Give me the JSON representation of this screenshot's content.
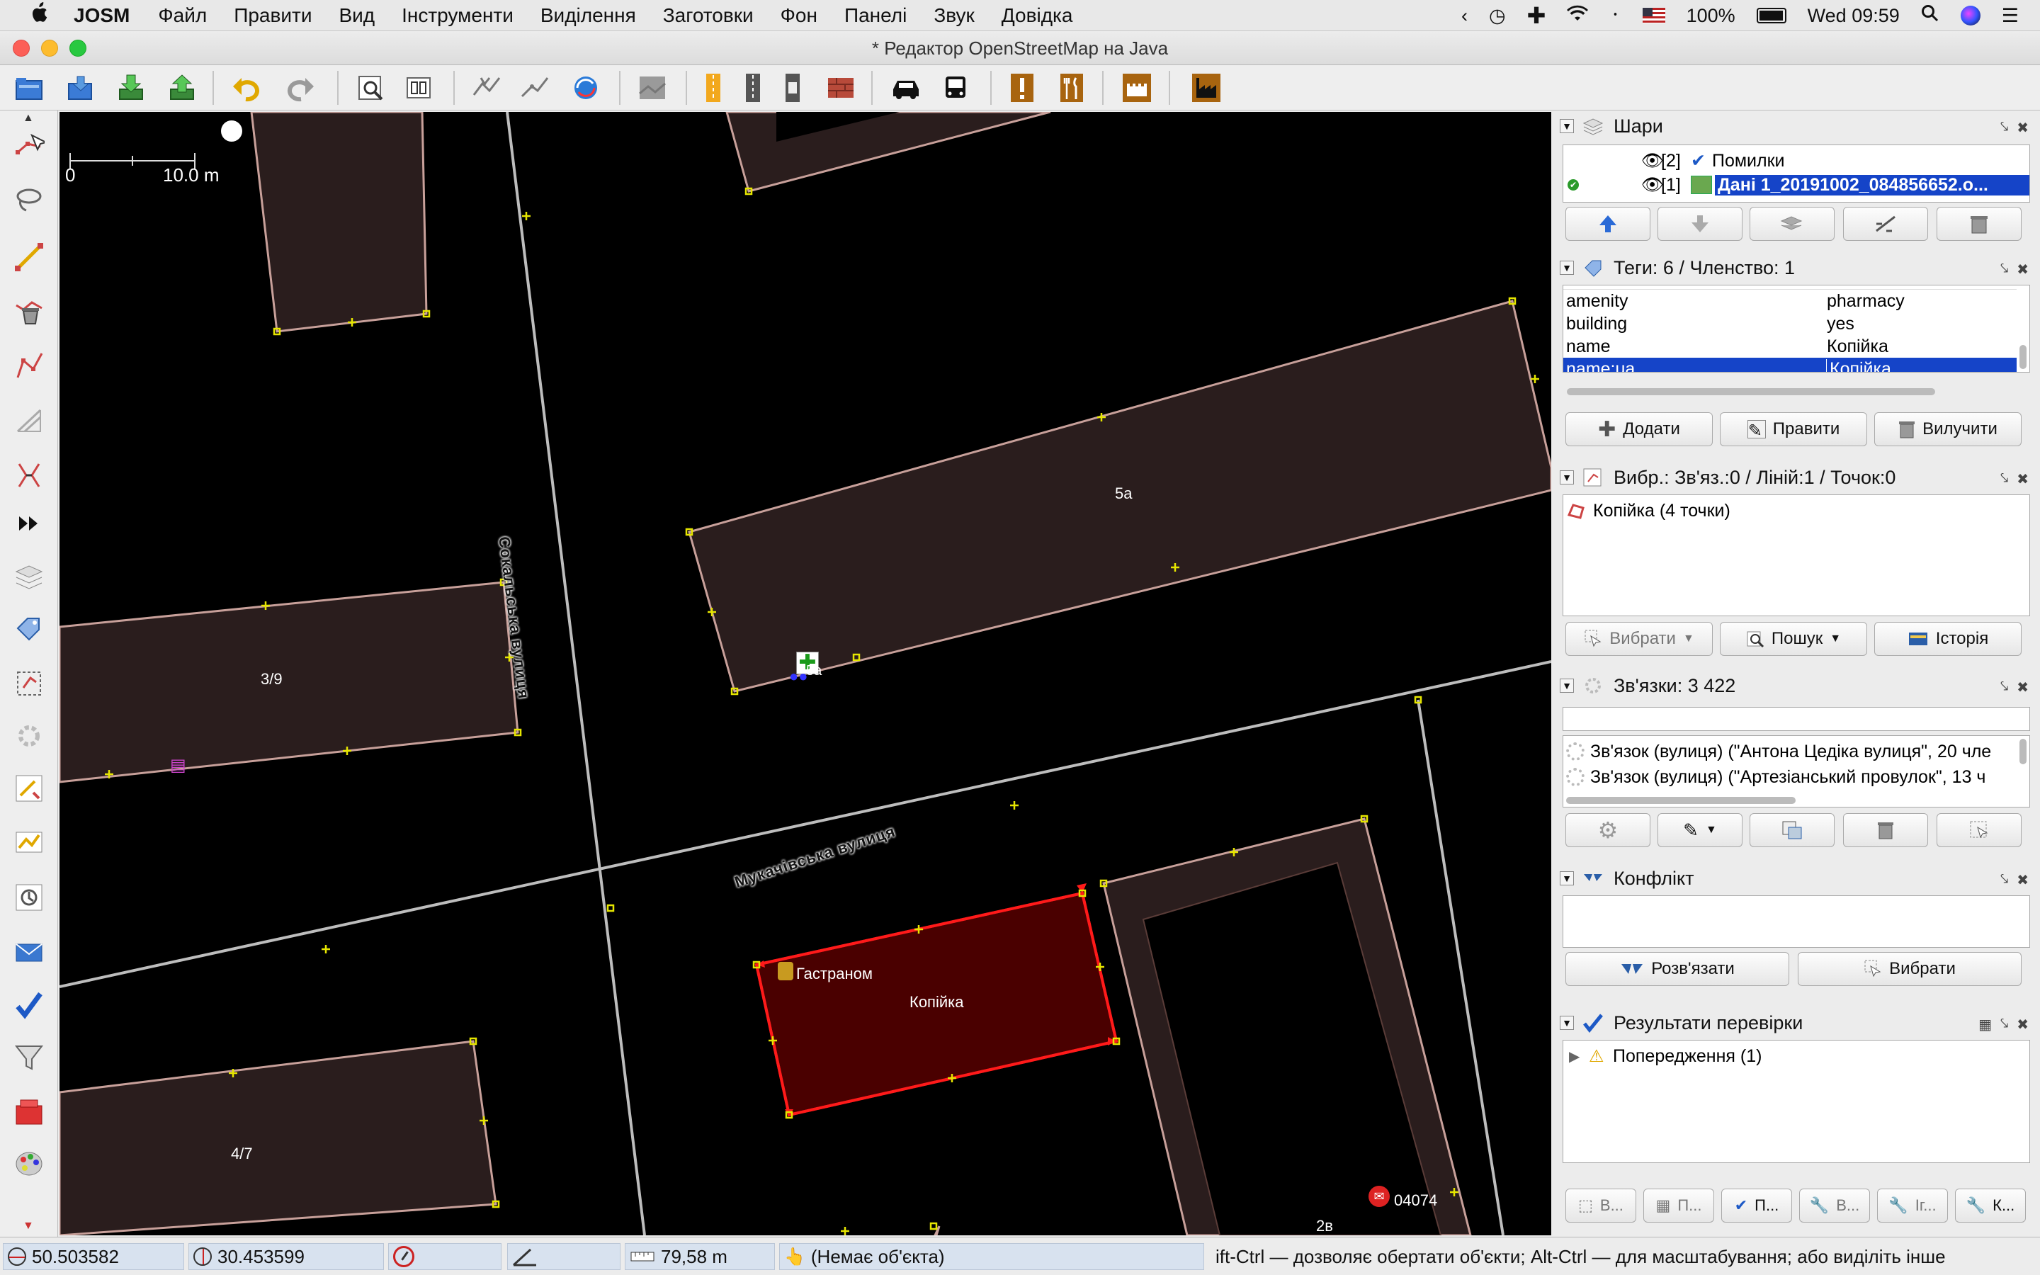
{
  "menubar": {
    "apple": "",
    "app": "JOSM",
    "items": [
      "Файл",
      "Правити",
      "Вид",
      "Інструменти",
      "Виділення",
      "Заготовки",
      "Фон",
      "Панелі",
      "Звук",
      "Довідка"
    ],
    "battery": "100%",
    "clock": "Wed 09:59"
  },
  "window": {
    "title": "* Редактор OpenStreetMap на Java"
  },
  "map": {
    "scale_zero": "0",
    "scale_label": "10.0 m",
    "streets": [
      "Сокальська вулиця",
      "Мукачівська вулиця"
    ],
    "buildings": [
      "5а",
      "3/9",
      "4/7",
      "Копійка",
      "2в"
    ],
    "poi_labels": [
      "5а",
      "Гастраном",
      "04074"
    ],
    "colors": {
      "selected": "#ff1a1a",
      "building_fill": "#2a1d1d",
      "building_outline": "#c8a09a",
      "node": "#e6e600",
      "road": "#bdbdbd"
    }
  },
  "layers": {
    "title": "Шари",
    "items": [
      {
        "index": "[2]",
        "name": "Помилки",
        "selected": false
      },
      {
        "index": "[1]",
        "name": "Дані 1_20191002_084856652.o...",
        "selected": true
      }
    ]
  },
  "tags": {
    "title": "Теги: 6 / Членство: 1",
    "rows": [
      {
        "key": "amenity",
        "value": "pharmacy"
      },
      {
        "key": "building",
        "value": "yes"
      },
      {
        "key": "name",
        "value": "Копійка"
      },
      {
        "key": "name:ua",
        "value": "Копійка"
      }
    ],
    "add": "Додати",
    "edit": "Правити",
    "delete": "Вилучити"
  },
  "selection": {
    "title": "Вибр.: Зв'яз.:0 / Ліній:1 / Точок:0",
    "items": [
      "Копійка (4 точки)"
    ],
    "select": "Вибрати",
    "search": "Пошук",
    "history": "Історія"
  },
  "relations": {
    "title": "Зв'язки: 3 422",
    "filter_placeholder": "",
    "items": [
      "Зв'язок (вулиця) (\"Антона Цедіка вулиця\", 20 чле",
      "Зв'язок (вулиця) (\"Артезіанський провулок\", 13 ч"
    ]
  },
  "conflict": {
    "title": "Конфлікт",
    "resolve": "Розв'язати",
    "select": "Вибрати"
  },
  "validation": {
    "title": "Результати перевірки",
    "items": [
      "Попередження (1)"
    ],
    "buttons": [
      "В...",
      "П...",
      "П...",
      "В...",
      "Іг...",
      "К..."
    ]
  },
  "status": {
    "lat": "50.503582",
    "lon": "30.453599",
    "distance": "79,58 m",
    "object": "(Немає об'єкта)",
    "hint": "ift-Ctrl — дозволяє обертати об'єкти; Alt-Ctrl — для масштабування; або виділіть інше"
  }
}
